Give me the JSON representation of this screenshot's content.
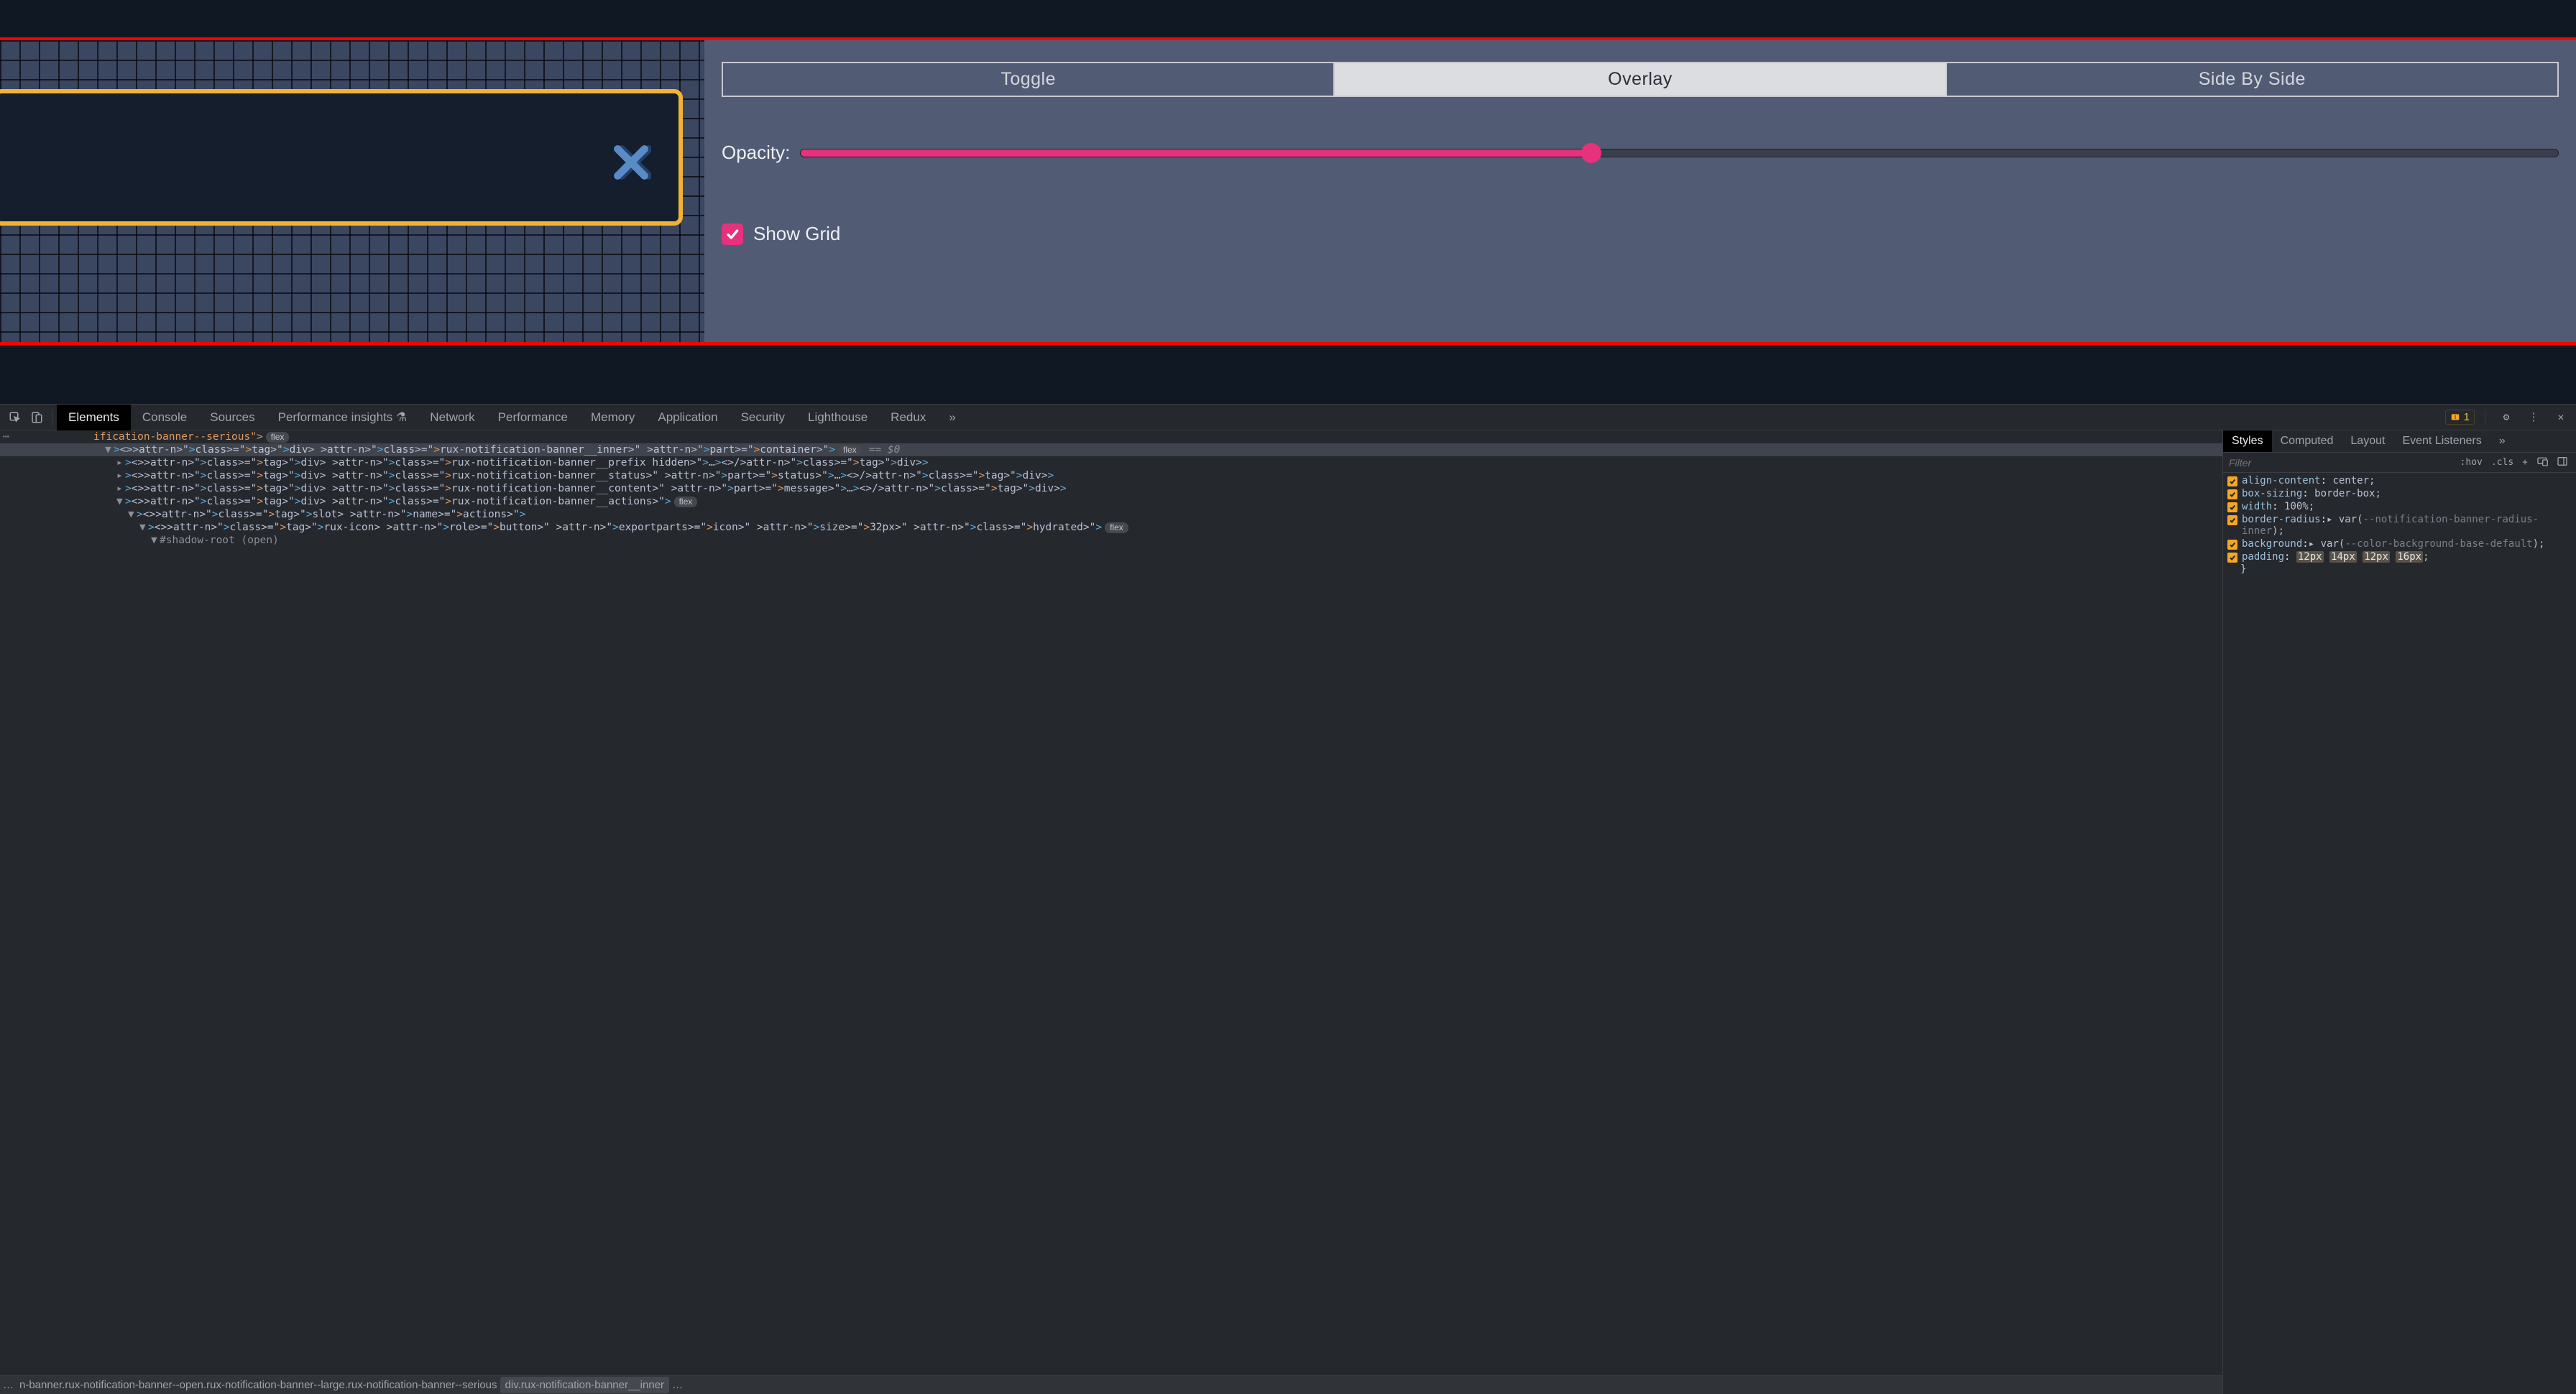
{
  "panel": {
    "modes": {
      "toggle": "Toggle",
      "overlay": "Overlay",
      "sidebyside": "Side By Side",
      "active": "overlay"
    },
    "opacity_label": "Opacity:",
    "opacity_value": 45,
    "show_grid_label": "Show Grid",
    "show_grid_checked": true
  },
  "devtools": {
    "tabs": [
      "Elements",
      "Console",
      "Sources",
      "Performance insights",
      "Network",
      "Performance",
      "Memory",
      "Application",
      "Security",
      "Lighthouse",
      "Redux"
    ],
    "active_tab": "Elements",
    "more_glyph": "»",
    "warn_count": "1",
    "dom": {
      "truncated": "ification-banner--serious\">",
      "truncated_pill": "flex",
      "line_sel_open": "<div class=\"rux-notification-banner__inner\" part=\"container\">",
      "line_sel_pill": "flex",
      "line_sel_eq": "== $0",
      "l_prefix": "<div class=\"rux-notification-banner__prefix hidden\">…</div>",
      "l_status": "<div class=\"rux-notification-banner__status\" part=\"status\">…</div>",
      "l_content": "<div class=\"rux-notification-banner__content\" part=\"message\">…</div>",
      "l_actions": "<div class=\"rux-notification-banner__actions\">",
      "l_actions_pill": "flex",
      "l_slot": "<slot name=\"actions\">",
      "l_icon": "<rux-icon role=\"button\" exportparts=\"icon\" size=\"32px\" class=\"hydrated\">",
      "l_icon_pill": "flex",
      "l_shadow": "#shadow-root (open)"
    },
    "crumbs": {
      "dots": "…",
      "c1": "n-banner.rux-notification-banner--open.rux-notification-banner--large.rux-notification-banner--serious",
      "c2": "div.rux-notification-banner__inner",
      "trailing": "…"
    },
    "styles": {
      "tabs": [
        "Styles",
        "Computed",
        "Layout",
        "Event Listeners"
      ],
      "active": "Styles",
      "more": "»",
      "filter_placeholder": "Filter",
      "hov": ":hov",
      "cls": ".cls",
      "plus": "+",
      "rules": [
        {
          "prop": "align-content",
          "val": "center;"
        },
        {
          "prop": "box-sizing",
          "val": "border-box;"
        },
        {
          "prop": "width",
          "val": "100%;"
        },
        {
          "prop": "border-radius",
          "val_pre": "▸ var(",
          "var": "--notification-banner-radius-inner",
          "val_post": ");"
        },
        {
          "prop": "background",
          "val_pre": "▸ var(",
          "var": "--color-background-base-default",
          "val_post": ");"
        },
        {
          "prop": "padding",
          "pad": [
            "12px",
            "14px",
            "12px",
            "16px"
          ],
          "tail": ";"
        }
      ],
      "closebrace": "}"
    }
  }
}
